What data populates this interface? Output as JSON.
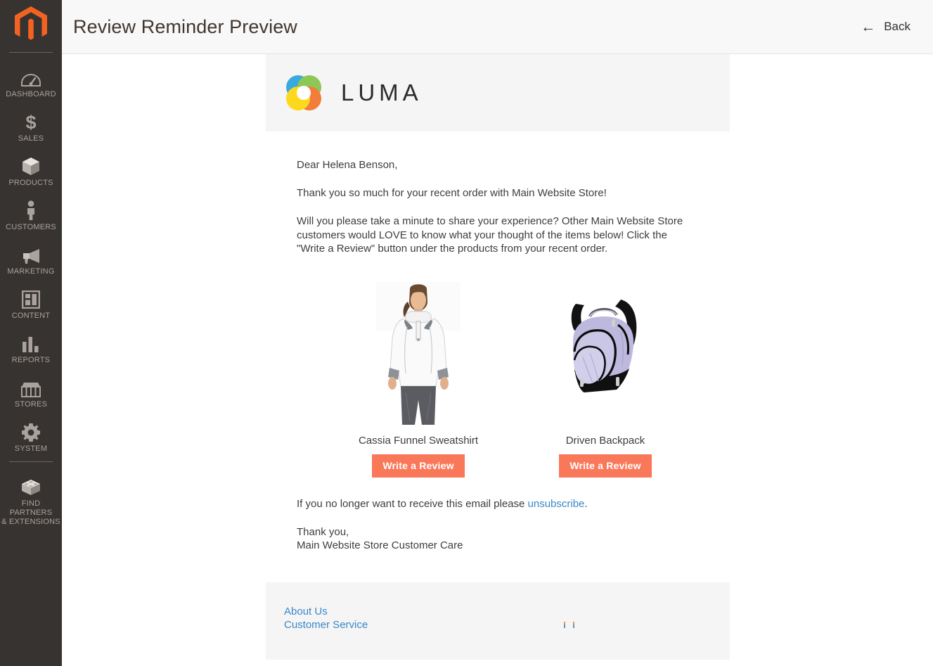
{
  "sidebar": {
    "logo_icon": "magento-logo-icon",
    "items": [
      {
        "label": "DASHBOARD",
        "icon": "dashboard-gauge-icon"
      },
      {
        "label": "SALES",
        "icon": "dollar-sign-icon"
      },
      {
        "label": "PRODUCTS",
        "icon": "box-icon"
      },
      {
        "label": "CUSTOMERS",
        "icon": "person-icon"
      },
      {
        "label": "MARKETING",
        "icon": "megaphone-icon"
      },
      {
        "label": "CONTENT",
        "icon": "layout-page-icon"
      },
      {
        "label": "REPORTS",
        "icon": "bar-chart-icon"
      },
      {
        "label": "STORES",
        "icon": "storefront-icon"
      },
      {
        "label": "SYSTEM",
        "icon": "gear-icon"
      }
    ],
    "footer_item": {
      "label": "FIND PARTNERS\n& EXTENSIONS",
      "line1": "FIND PARTNERS",
      "line2": "& EXTENSIONS",
      "icon": "extension-block-icon"
    }
  },
  "header": {
    "title": "Review Reminder Preview",
    "back_label": "Back",
    "back_icon": "arrow-left-icon"
  },
  "email": {
    "brand": {
      "logo_icon": "luma-rings-icon",
      "wordmark": "LUMA"
    },
    "greeting": "Dear Helena Benson,",
    "paragraph_1": "Thank you so much for your recent order with Main Website Store!",
    "paragraph_2": "Will you please take a minute to share your experience? Other Main Website Store customers would LOVE to know what your thought of the items below! Click the \"Write a Review\" button under the products from your recent order.",
    "products": [
      {
        "name": "Cassia Funnel Sweatshirt",
        "button_label": "Write a Review",
        "image_icon": "product-photo-sweatshirt"
      },
      {
        "name": "Driven Backpack",
        "button_label": "Write a Review",
        "image_icon": "product-photo-backpack"
      }
    ],
    "unsubscribe_prefix": "If you no longer want to receive this email please ",
    "unsubscribe_link": "unsubscribe",
    "unsubscribe_suffix": ".",
    "signoff_line_1": "Thank you,",
    "signoff_line_2": "Main Website Store Customer Care",
    "footer_links": [
      {
        "label": "About Us"
      },
      {
        "label": "Customer Service"
      }
    ]
  },
  "colors": {
    "sidebar_bg": "#373330",
    "magento_orange": "#f26322",
    "button_orange": "#f9785a",
    "link_blue": "#3a87c8",
    "header_bg": "#f8f8f8",
    "email_band_bg": "#f5f5f5"
  }
}
